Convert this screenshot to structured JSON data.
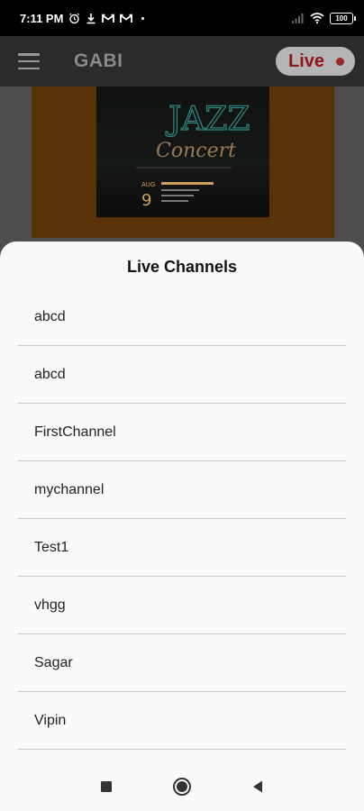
{
  "status_bar": {
    "time": "7:11 PM",
    "battery": "100"
  },
  "app_bar": {
    "title": "GABI",
    "live_label": "Live"
  },
  "poster": {
    "title_line1": "JAZZ",
    "title_line2": "Concert",
    "month": "AUG",
    "day": "9"
  },
  "sheet": {
    "title": "Live Channels",
    "channels": [
      "abcd",
      "abcd",
      "FirstChannel",
      "mychannel",
      "Test1",
      "vhgg",
      "Sagar",
      "Vipin"
    ]
  },
  "colors": {
    "live_text": "#8e1616",
    "banner": "#5a3208",
    "sheet_bg": "#fafafa"
  }
}
